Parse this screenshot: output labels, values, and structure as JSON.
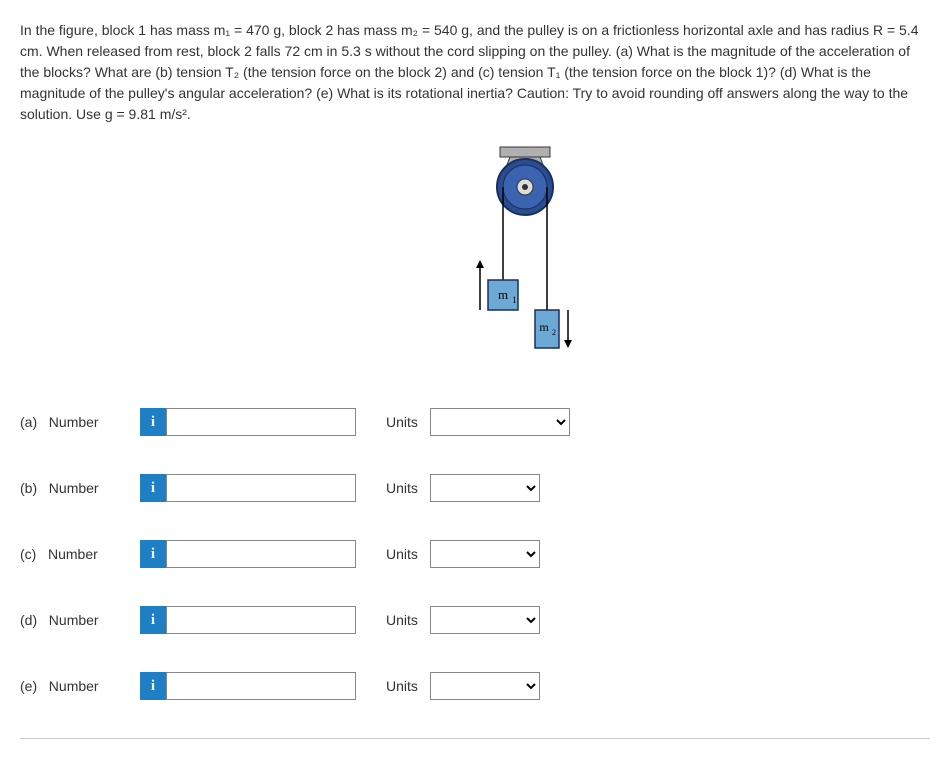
{
  "problem_text": "In the figure, block 1 has mass m₁ = 470 g, block 2 has mass m₂ = 540 g, and the pulley is on a frictionless horizontal axle and has radius R = 5.4 cm. When released from rest, block 2 falls 72 cm in 5.3 s without the cord slipping on the pulley. (a) What is the magnitude of the acceleration of the blocks? What are (b) tension T₂ (the tension force on the block 2) and (c) tension T₁ (the tension force on the block 1)? (d) What is the magnitude of the pulley's angular acceleration? (e) What is its rotational inertia? Caution: Try to avoid rounding off answers along the way to the solution. Use g = 9.81 m/s².",
  "figure": {
    "block1_label": "m₁",
    "block2_label": "m₂"
  },
  "rows": [
    {
      "part": "(a)",
      "number_label": "Number",
      "info": "i",
      "units_label": "Units",
      "units_width": 140
    },
    {
      "part": "(b)",
      "number_label": "Number",
      "info": "i",
      "units_label": "Units",
      "units_width": 110
    },
    {
      "part": "(c)",
      "number_label": "Number",
      "info": "i",
      "units_label": "Units",
      "units_width": 110
    },
    {
      "part": "(d)",
      "number_label": "Number",
      "info": "i",
      "units_label": "Units",
      "units_width": 110
    },
    {
      "part": "(e)",
      "number_label": "Number",
      "info": "i",
      "units_label": "Units",
      "units_width": 110
    }
  ]
}
